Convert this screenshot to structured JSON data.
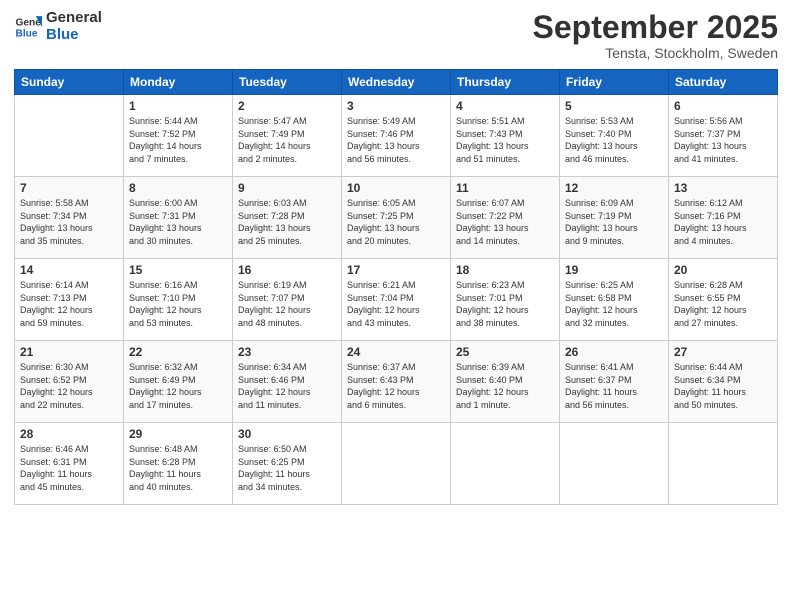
{
  "logo": {
    "line1": "General",
    "line2": "Blue"
  },
  "title": "September 2025",
  "subtitle": "Tensta, Stockholm, Sweden",
  "header_days": [
    "Sunday",
    "Monday",
    "Tuesday",
    "Wednesday",
    "Thursday",
    "Friday",
    "Saturday"
  ],
  "weeks": [
    [
      {
        "day": "",
        "info": ""
      },
      {
        "day": "1",
        "info": "Sunrise: 5:44 AM\nSunset: 7:52 PM\nDaylight: 14 hours\nand 7 minutes."
      },
      {
        "day": "2",
        "info": "Sunrise: 5:47 AM\nSunset: 7:49 PM\nDaylight: 14 hours\nand 2 minutes."
      },
      {
        "day": "3",
        "info": "Sunrise: 5:49 AM\nSunset: 7:46 PM\nDaylight: 13 hours\nand 56 minutes."
      },
      {
        "day": "4",
        "info": "Sunrise: 5:51 AM\nSunset: 7:43 PM\nDaylight: 13 hours\nand 51 minutes."
      },
      {
        "day": "5",
        "info": "Sunrise: 5:53 AM\nSunset: 7:40 PM\nDaylight: 13 hours\nand 46 minutes."
      },
      {
        "day": "6",
        "info": "Sunrise: 5:56 AM\nSunset: 7:37 PM\nDaylight: 13 hours\nand 41 minutes."
      }
    ],
    [
      {
        "day": "7",
        "info": "Sunrise: 5:58 AM\nSunset: 7:34 PM\nDaylight: 13 hours\nand 35 minutes."
      },
      {
        "day": "8",
        "info": "Sunrise: 6:00 AM\nSunset: 7:31 PM\nDaylight: 13 hours\nand 30 minutes."
      },
      {
        "day": "9",
        "info": "Sunrise: 6:03 AM\nSunset: 7:28 PM\nDaylight: 13 hours\nand 25 minutes."
      },
      {
        "day": "10",
        "info": "Sunrise: 6:05 AM\nSunset: 7:25 PM\nDaylight: 13 hours\nand 20 minutes."
      },
      {
        "day": "11",
        "info": "Sunrise: 6:07 AM\nSunset: 7:22 PM\nDaylight: 13 hours\nand 14 minutes."
      },
      {
        "day": "12",
        "info": "Sunrise: 6:09 AM\nSunset: 7:19 PM\nDaylight: 13 hours\nand 9 minutes."
      },
      {
        "day": "13",
        "info": "Sunrise: 6:12 AM\nSunset: 7:16 PM\nDaylight: 13 hours\nand 4 minutes."
      }
    ],
    [
      {
        "day": "14",
        "info": "Sunrise: 6:14 AM\nSunset: 7:13 PM\nDaylight: 12 hours\nand 59 minutes."
      },
      {
        "day": "15",
        "info": "Sunrise: 6:16 AM\nSunset: 7:10 PM\nDaylight: 12 hours\nand 53 minutes."
      },
      {
        "day": "16",
        "info": "Sunrise: 6:19 AM\nSunset: 7:07 PM\nDaylight: 12 hours\nand 48 minutes."
      },
      {
        "day": "17",
        "info": "Sunrise: 6:21 AM\nSunset: 7:04 PM\nDaylight: 12 hours\nand 43 minutes."
      },
      {
        "day": "18",
        "info": "Sunrise: 6:23 AM\nSunset: 7:01 PM\nDaylight: 12 hours\nand 38 minutes."
      },
      {
        "day": "19",
        "info": "Sunrise: 6:25 AM\nSunset: 6:58 PM\nDaylight: 12 hours\nand 32 minutes."
      },
      {
        "day": "20",
        "info": "Sunrise: 6:28 AM\nSunset: 6:55 PM\nDaylight: 12 hours\nand 27 minutes."
      }
    ],
    [
      {
        "day": "21",
        "info": "Sunrise: 6:30 AM\nSunset: 6:52 PM\nDaylight: 12 hours\nand 22 minutes."
      },
      {
        "day": "22",
        "info": "Sunrise: 6:32 AM\nSunset: 6:49 PM\nDaylight: 12 hours\nand 17 minutes."
      },
      {
        "day": "23",
        "info": "Sunrise: 6:34 AM\nSunset: 6:46 PM\nDaylight: 12 hours\nand 11 minutes."
      },
      {
        "day": "24",
        "info": "Sunrise: 6:37 AM\nSunset: 6:43 PM\nDaylight: 12 hours\nand 6 minutes."
      },
      {
        "day": "25",
        "info": "Sunrise: 6:39 AM\nSunset: 6:40 PM\nDaylight: 12 hours\nand 1 minute."
      },
      {
        "day": "26",
        "info": "Sunrise: 6:41 AM\nSunset: 6:37 PM\nDaylight: 11 hours\nand 56 minutes."
      },
      {
        "day": "27",
        "info": "Sunrise: 6:44 AM\nSunset: 6:34 PM\nDaylight: 11 hours\nand 50 minutes."
      }
    ],
    [
      {
        "day": "28",
        "info": "Sunrise: 6:46 AM\nSunset: 6:31 PM\nDaylight: 11 hours\nand 45 minutes."
      },
      {
        "day": "29",
        "info": "Sunrise: 6:48 AM\nSunset: 6:28 PM\nDaylight: 11 hours\nand 40 minutes."
      },
      {
        "day": "30",
        "info": "Sunrise: 6:50 AM\nSunset: 6:25 PM\nDaylight: 11 hours\nand 34 minutes."
      },
      {
        "day": "",
        "info": ""
      },
      {
        "day": "",
        "info": ""
      },
      {
        "day": "",
        "info": ""
      },
      {
        "day": "",
        "info": ""
      }
    ]
  ]
}
